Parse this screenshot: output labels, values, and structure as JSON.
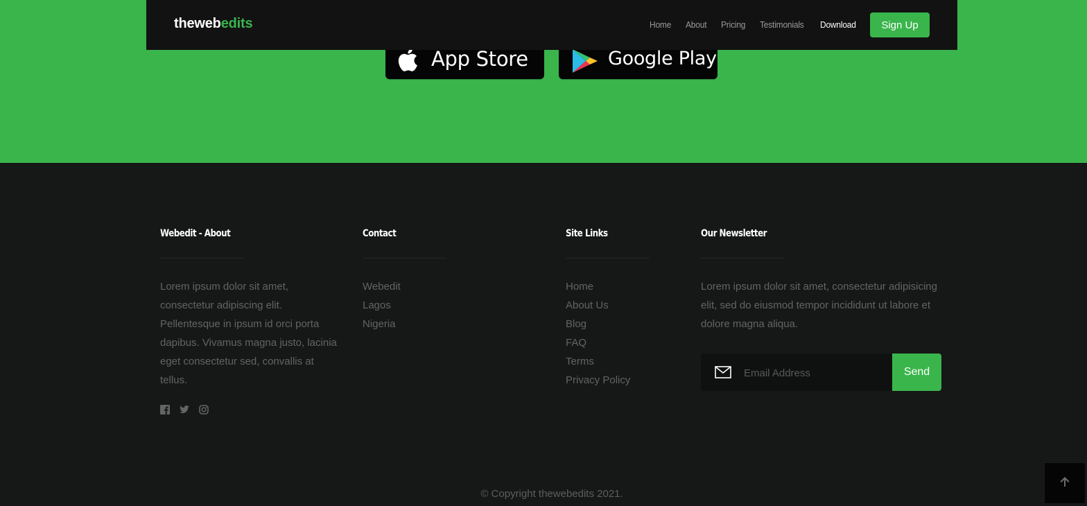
{
  "brand": {
    "prefix": "theweb",
    "accent": "edits"
  },
  "nav": {
    "links": [
      "Home",
      "About",
      "Pricing",
      "Testimonials",
      "Download"
    ],
    "active": "Download",
    "signup_label": "Sign Up"
  },
  "stores": {
    "app_store_label": "App Store",
    "google_play_label": "Google Play"
  },
  "footer": {
    "about": {
      "heading": "Webedit - About",
      "text": "Lorem ipsum dolor sit amet, consectetur adipiscing elit. Pellentesque in ipsum id orci porta dapibus. Vivamus magna justo, lacinia eget consectetur sed, convallis at tellus.",
      "social_icons": [
        "facebook-icon",
        "twitter-icon",
        "instagram-icon"
      ]
    },
    "contact": {
      "heading": "Contact",
      "items": [
        "Webedit",
        "Lagos",
        "Nigeria"
      ]
    },
    "site_links": {
      "heading": "Site Links",
      "items": [
        "Home",
        "About Us",
        "Blog",
        "FAQ",
        "Terms",
        "Privacy Policy"
      ]
    },
    "newsletter": {
      "heading": "Our Newsletter",
      "text": "Lorem ipsum dolor sit amet, consectetur adipisicing elit, sed do eiusmod tempor incididunt ut labore et dolore magna aliqua.",
      "email_placeholder": "Email Address",
      "email_value": "",
      "send_label": "Send"
    },
    "copyright": "© Copyright thewebedits 2021."
  },
  "colors": {
    "accent": "#3ab54c",
    "footer_bg": "#161717",
    "navbar_bg": "#121212",
    "muted_text": "#636465"
  }
}
